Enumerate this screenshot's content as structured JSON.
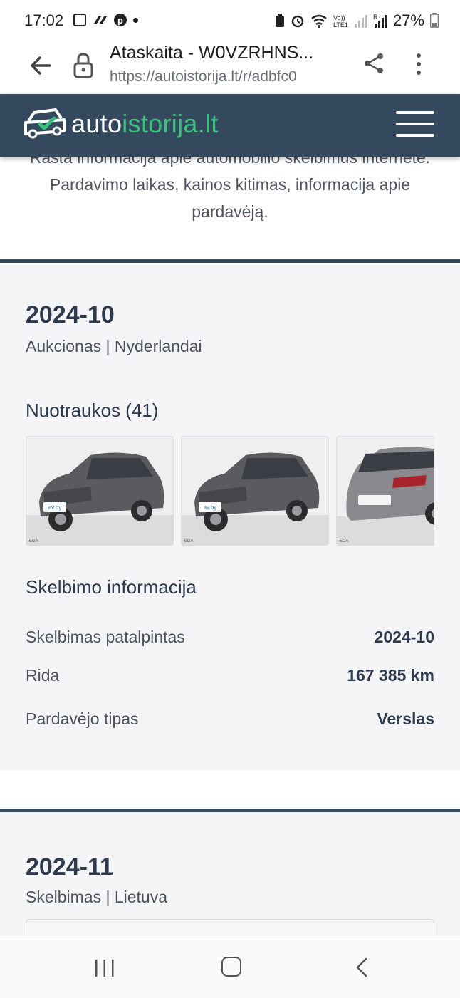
{
  "status_bar": {
    "time": "17:02",
    "battery": "27%",
    "left_icons": [
      "check-box-icon",
      "link-icon",
      "pinterest-icon",
      "notification-dot-icon"
    ],
    "right_icons": [
      "tag-icon",
      "alarm-icon",
      "wifi-icon",
      "volte-icon",
      "signal-icon",
      "signal-r-icon",
      "battery-icon"
    ]
  },
  "browser": {
    "title": "Ataskaita - W0VZRHNS...",
    "url": "https://autoistorija.lt/r/adbfc0"
  },
  "site": {
    "logo_part1": "auto",
    "logo_part2": "istorija.lt",
    "brand_color": "#34495e",
    "accent_color": "#37c47a"
  },
  "intro": {
    "line1": "Rasta informacija apie automobilio skelbimus internete.",
    "line2": "Pardavimo laikas, kainos kitimas, informacija apie",
    "line3": "pardavėją."
  },
  "listing1": {
    "date": "2024-10",
    "subtitle": "Aukcionas | Nyderlandai",
    "photos_label": "Nuotraukos (41)",
    "photos": [
      {
        "plate": "av.by",
        "tag": "EDA"
      },
      {
        "plate": "av.by",
        "tag": "EDA"
      },
      {
        "tag": "EDA"
      }
    ],
    "info_title": "Skelbimo informacija",
    "rows": [
      {
        "label": "Skelbimas patalpintas",
        "value": "2024-10"
      },
      {
        "label": "Rida",
        "value": "167 385 km"
      },
      {
        "label": "Pardavėjo tipas",
        "value": "Verslas"
      }
    ]
  },
  "listing2": {
    "date": "2024-11",
    "subtitle": "Skelbimas | Lietuva"
  }
}
